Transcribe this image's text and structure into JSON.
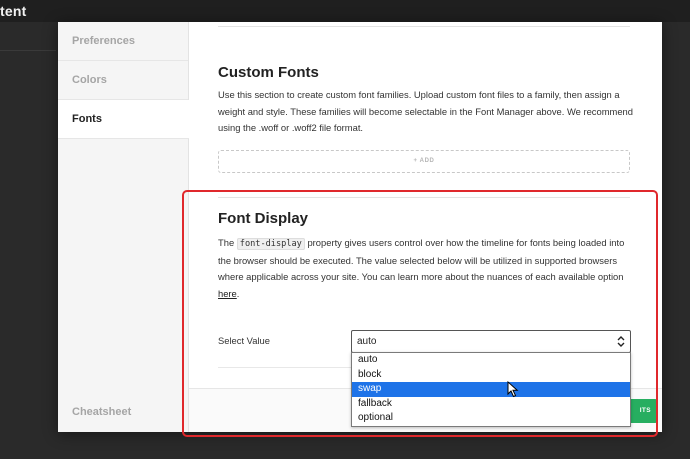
{
  "background": {
    "title": "tent"
  },
  "sidebar": {
    "items": [
      {
        "label": "Preferences"
      },
      {
        "label": "Colors"
      },
      {
        "label": "Fonts"
      }
    ],
    "cheatsheet_label": "Cheatsheet"
  },
  "custom_fonts": {
    "title": "Custom Fonts",
    "description": "Use this section to create custom font families. Upload custom font files to a family, then assign a weight and style. These families will become selectable in the Font Manager above. We recommend using the .woff or .woff2 file format.",
    "add_label": "+ ADD"
  },
  "font_display": {
    "title": "Font Display",
    "desc_prefix": "The ",
    "desc_code": "font-display",
    "desc_middle": " property gives users control over how the timeline for fonts being loaded into the browser should be executed. The value selected below will be utilized in supported browsers where applicable across your site. You can learn more about the nuances of each available option ",
    "desc_link": "here",
    "desc_suffix": ".",
    "select_label": "Select Value",
    "selected_value": "auto",
    "options": [
      "auto",
      "block",
      "swap",
      "fallback",
      "optional"
    ],
    "highlighted_option": "swap"
  },
  "footer": {
    "save_label": "ITS"
  },
  "colors": {
    "annotation": "#e0282c",
    "highlight": "#1e73e8",
    "save_button": "#27ae60"
  }
}
